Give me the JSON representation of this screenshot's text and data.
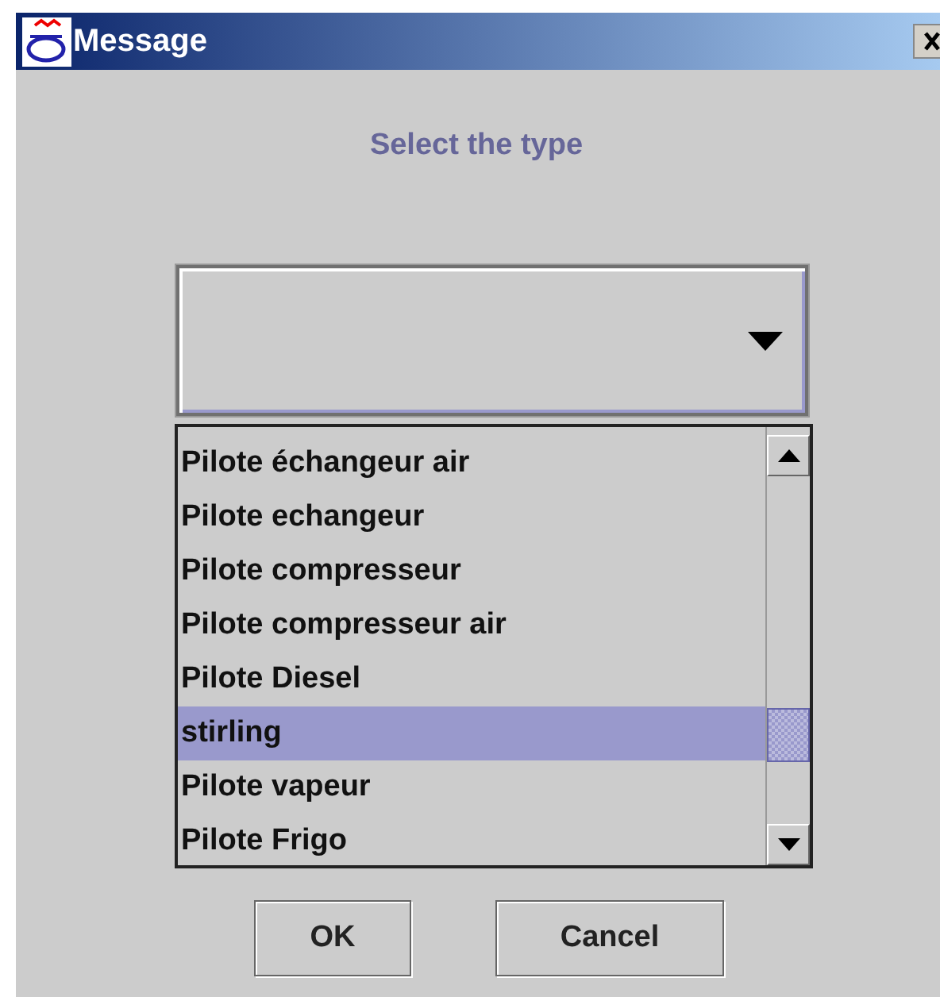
{
  "window": {
    "title": "Message"
  },
  "prompt": "Select the type",
  "combo": {
    "expanded": true
  },
  "list": {
    "items": [
      {
        "label": "Pilote échangeur air",
        "selected": false
      },
      {
        "label": "Pilote echangeur",
        "selected": false
      },
      {
        "label": "Pilote compresseur",
        "selected": false
      },
      {
        "label": "Pilote compresseur air",
        "selected": false
      },
      {
        "label": "Pilote Diesel",
        "selected": false
      },
      {
        "label": "stirling",
        "selected": true
      },
      {
        "label": "Pilote vapeur",
        "selected": false
      },
      {
        "label": "Pilote Frigo",
        "selected": false
      }
    ]
  },
  "buttons": [
    "OK",
    "Cancel"
  ]
}
